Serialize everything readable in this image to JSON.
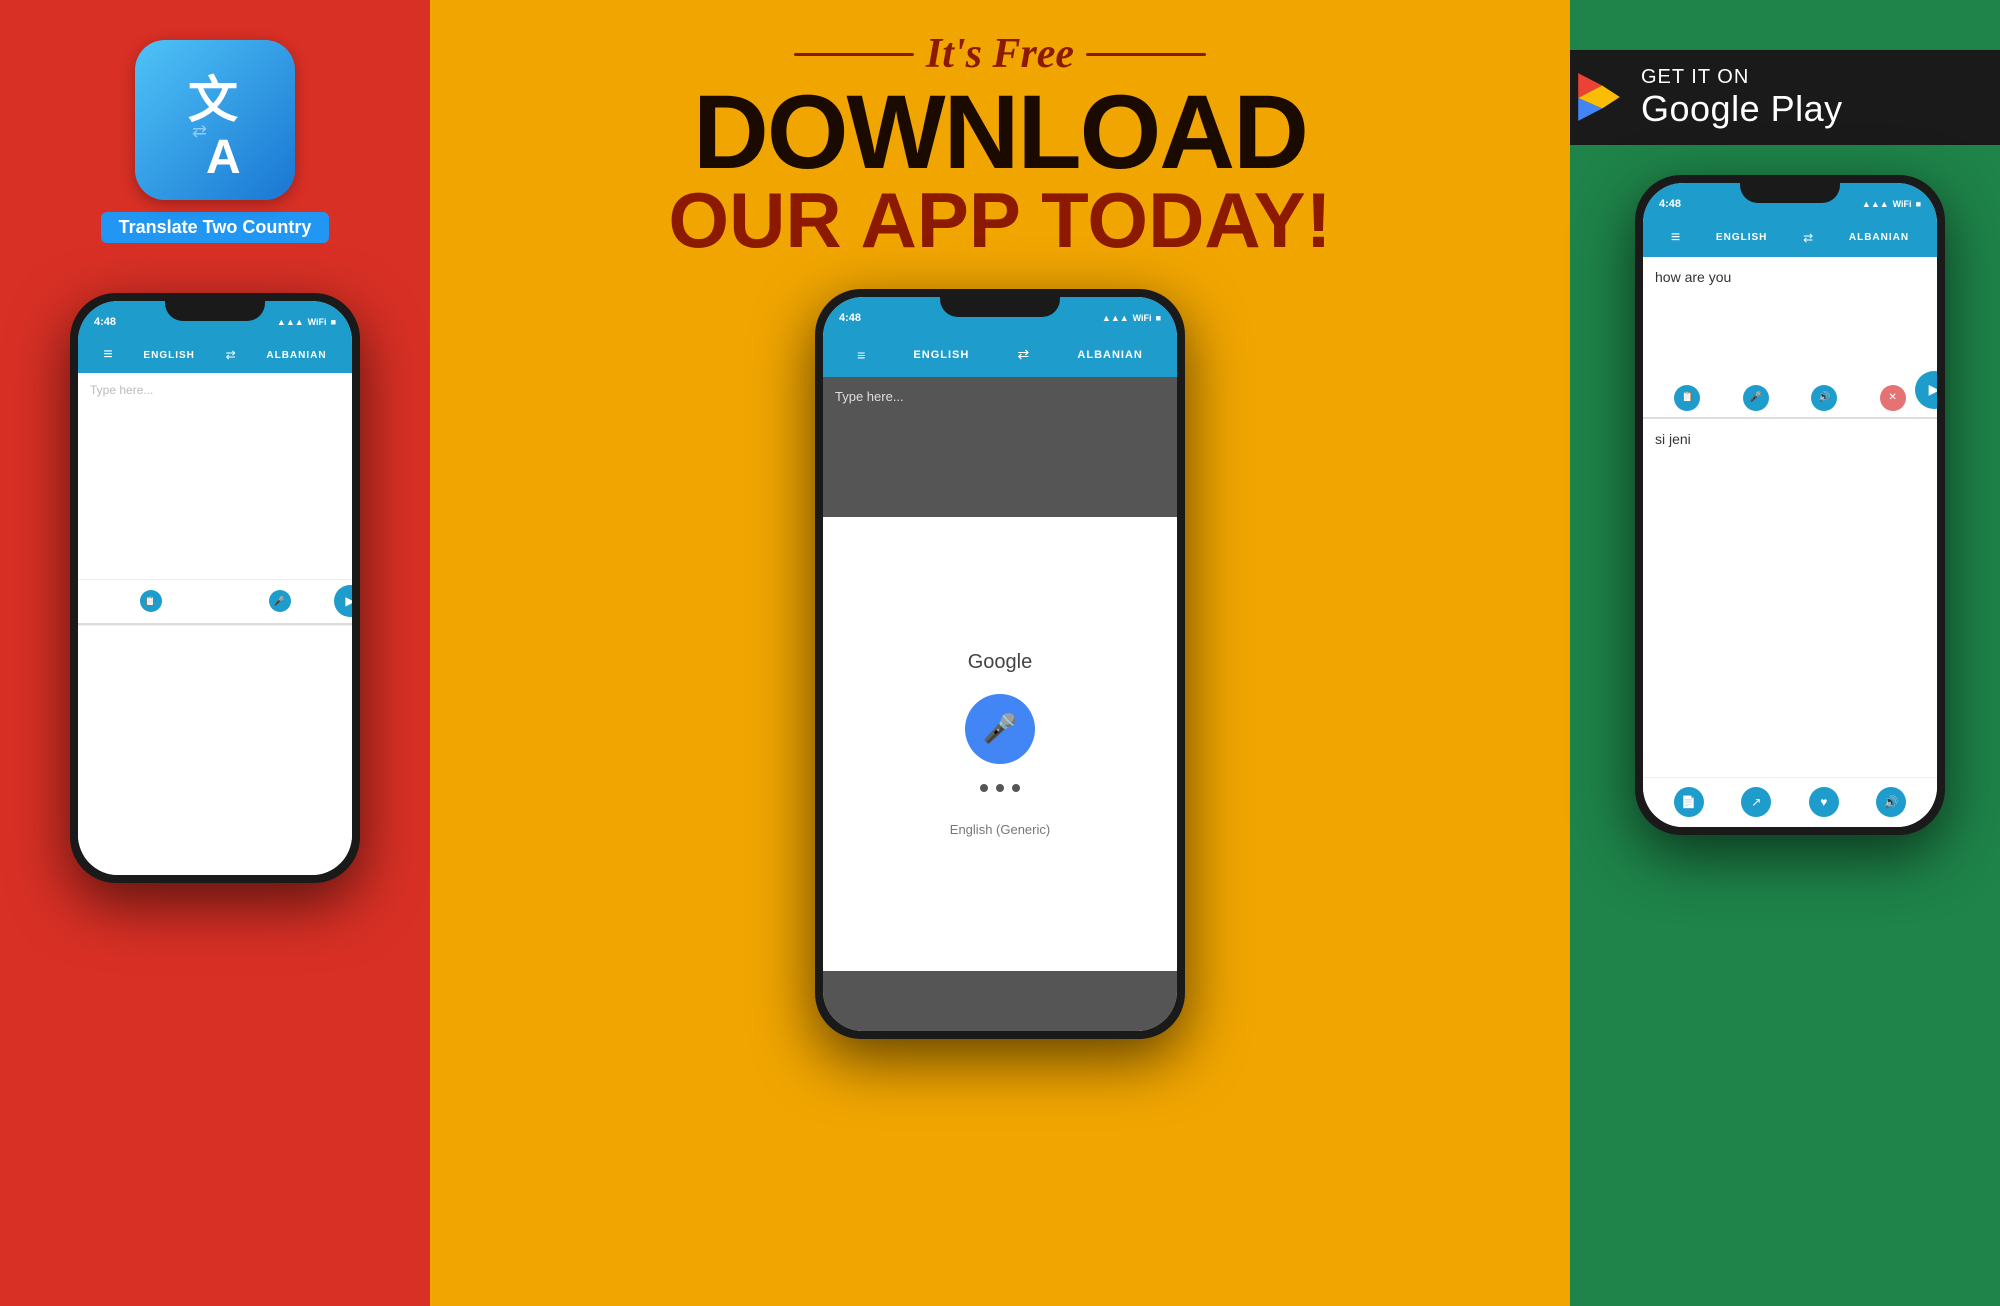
{
  "left": {
    "app_icon_label": "Translate Two Country",
    "app_bg": "#d93025",
    "phone": {
      "time": "4:48",
      "lang_from": "ENGLISH",
      "lang_to": "ALBANIAN",
      "placeholder": "Type here...",
      "output_text": ""
    }
  },
  "center": {
    "bg": "#f0a500",
    "headline_italic": "It's Free",
    "headline_main": "DOWNLOAD",
    "headline_sub": "OUR APP TODAY!",
    "phone": {
      "time": "4:48",
      "lang_from": "ENGLISH",
      "lang_to": "ALBANIAN",
      "placeholder": "Type here...",
      "google_label": "Google",
      "listening_lang": "English (Generic)"
    }
  },
  "right": {
    "bg": "#1e8449",
    "google_play": {
      "get_it_on": "GET IT ON",
      "store_name": "Google Play"
    },
    "phone": {
      "time": "4:48",
      "lang_from": "ENGLISH",
      "lang_to": "ALBANIAN",
      "input_text": "how are you",
      "output_text": "si jeni"
    }
  },
  "icons": {
    "menu": "≡",
    "swap": "⇄",
    "clipboard": "📋",
    "mic": "🎤",
    "speaker": "🔊",
    "close": "✕",
    "send": "▶",
    "copy": "📄",
    "share": "↗",
    "heart": "♥",
    "volume": "🔊"
  }
}
